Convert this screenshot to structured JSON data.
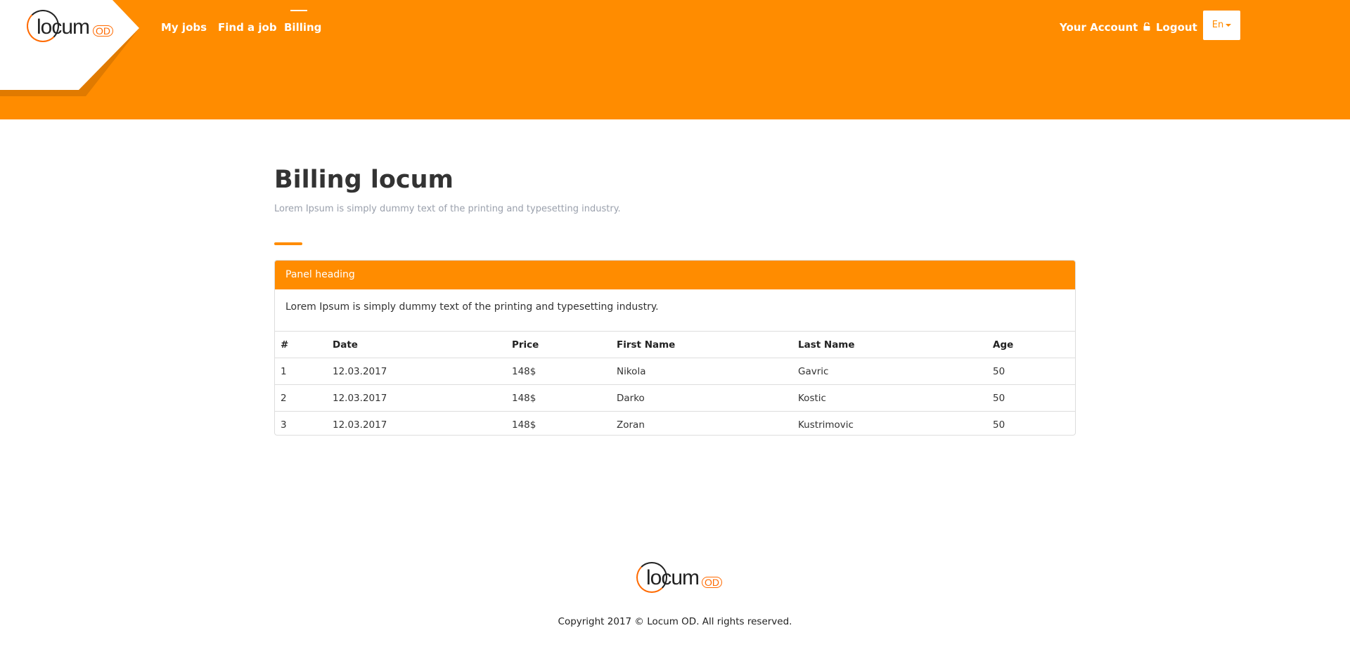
{
  "header": {
    "logo_text": "locum",
    "logo_suffix": "OD",
    "nav": [
      {
        "label": "My jobs"
      },
      {
        "label": "Find a job"
      },
      {
        "label": "Billing",
        "active": true
      }
    ],
    "account_label": "Your Account",
    "logout_label": "Logout",
    "language": "En",
    "brand_color": "#ff8c00"
  },
  "page": {
    "title": "Billing locum",
    "subtitle": "Lorem Ipsum is simply dummy text of the printing and typesetting industry."
  },
  "panel": {
    "heading": "Panel heading",
    "body": "Lorem Ipsum is simply dummy text of the printing and typesetting industry.",
    "columns": [
      "#",
      "Date",
      "Price",
      "First Name",
      "Last Name",
      "Age"
    ],
    "rows": [
      [
        "1",
        "12.03.2017",
        "148$",
        "Nikola",
        "Gavric",
        "50"
      ],
      [
        "2",
        "12.03.2017",
        "148$",
        "Darko",
        "Kostic",
        "50"
      ],
      [
        "3",
        "12.03.2017",
        "148$",
        "Zoran",
        "Kustrimovic",
        "50"
      ]
    ]
  },
  "footer": {
    "logo_text": "locum",
    "logo_suffix": "OD",
    "copyright": "Copyright 2017 © Locum OD. All rights reserved."
  }
}
